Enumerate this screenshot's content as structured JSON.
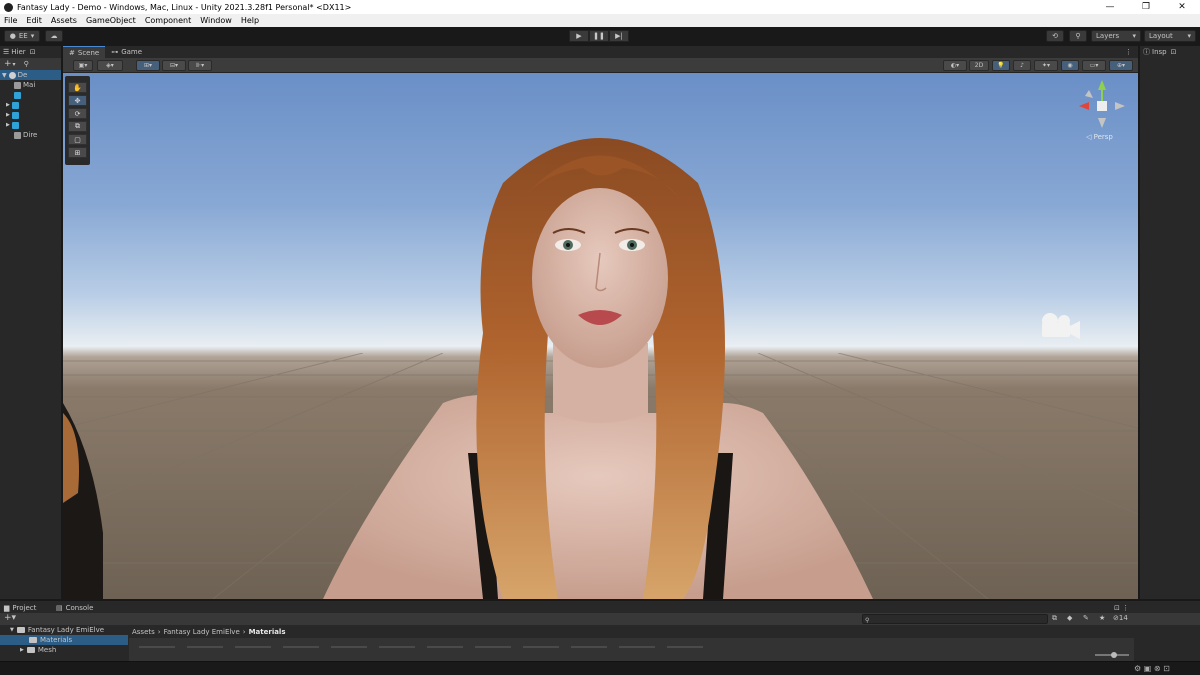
{
  "window": {
    "title": "Fantasy Lady - Demo - Windows, Mac, Linux - Unity 2021.3.28f1 Personal* <DX11>",
    "minimize": "—",
    "maximize": "❐",
    "close": "✕"
  },
  "menu": [
    "File",
    "Edit",
    "Assets",
    "GameObject",
    "Component",
    "Window",
    "Help"
  ],
  "toolbar": {
    "account": "EE",
    "layers": "Layers",
    "layout": "Layout"
  },
  "hierarchy": {
    "tab": "Hier",
    "items": [
      {
        "label": "De",
        "icon": "unity-scene-icon"
      },
      {
        "label": "Mai",
        "icon": "camera-icon"
      },
      {
        "label": "",
        "icon": "prefab-cube-icon"
      },
      {
        "label": "",
        "icon": "prefab-cube-icon"
      },
      {
        "label": "",
        "icon": "prefab-cube-icon"
      },
      {
        "label": "",
        "icon": "prefab-cube-icon"
      },
      {
        "label": "Dire",
        "icon": "light-icon"
      }
    ]
  },
  "scene": {
    "tabs": [
      "Scene",
      "Game"
    ],
    "mode_2d": "2D",
    "persp_label": "◁ Persp"
  },
  "inspector": {
    "tab": "Insp"
  },
  "bottom": {
    "tabs": [
      "Project",
      "Console"
    ],
    "tree": [
      "Fantasy Lady EmiElve",
      "Materials",
      "Mesh"
    ],
    "breadcrumb": [
      "Assets",
      "Fantasy Lady EmiElve",
      "Materials"
    ],
    "count": "14"
  },
  "colors": {
    "accent": "#4a8ad4",
    "selection": "#2c5d87",
    "panel": "#282828"
  }
}
